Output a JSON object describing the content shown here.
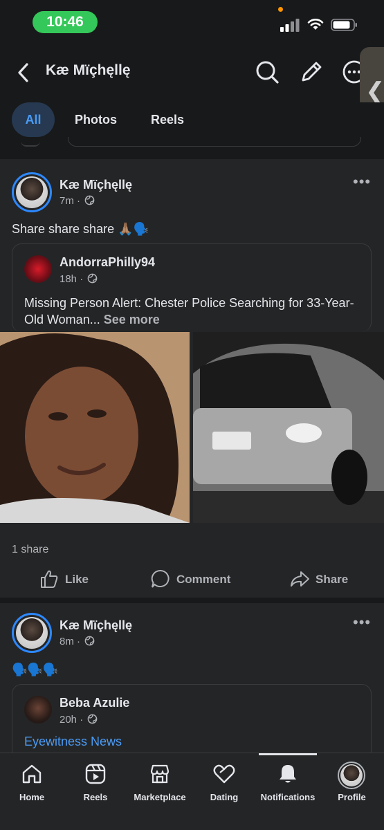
{
  "status_bar": {
    "time": "10:46"
  },
  "header": {
    "title": "Kæ Mïçhęllę"
  },
  "filter_tabs": [
    {
      "label": "All",
      "active": true
    },
    {
      "label": "Photos",
      "active": false
    },
    {
      "label": "Reels",
      "active": false
    }
  ],
  "posts": [
    {
      "author": "Kæ Mïçhęllę",
      "time": "7m",
      "text": "Share share share 🙏🏽🗣️",
      "shared": {
        "author": "AndorraPhilly94",
        "time": "18h",
        "text": "Missing Person Alert: Chester Police Searching for 33-Year-Old Woman...",
        "see_more": "See more"
      },
      "shares": "1 share",
      "actions": {
        "like": "Like",
        "comment": "Comment",
        "share": "Share"
      }
    },
    {
      "author": "Kæ Mïçhęllę",
      "time": "8m",
      "text": "🗣️🗣️🗣️",
      "shared": {
        "author": "Beba Azulie",
        "time": "20h",
        "link": "Eyewitness News"
      }
    }
  ],
  "bottom_nav": [
    {
      "label": "Home",
      "icon": "home-icon"
    },
    {
      "label": "Reels",
      "icon": "reels-icon"
    },
    {
      "label": "Marketplace",
      "icon": "marketplace-icon"
    },
    {
      "label": "Dating",
      "icon": "dating-icon"
    },
    {
      "label": "Notifications",
      "icon": "bell-icon",
      "active": true
    },
    {
      "label": "Profile",
      "icon": "profile-avatar"
    }
  ],
  "colors": {
    "accent": "#2d88ff",
    "status_green": "#34c759",
    "background": "#242526"
  }
}
